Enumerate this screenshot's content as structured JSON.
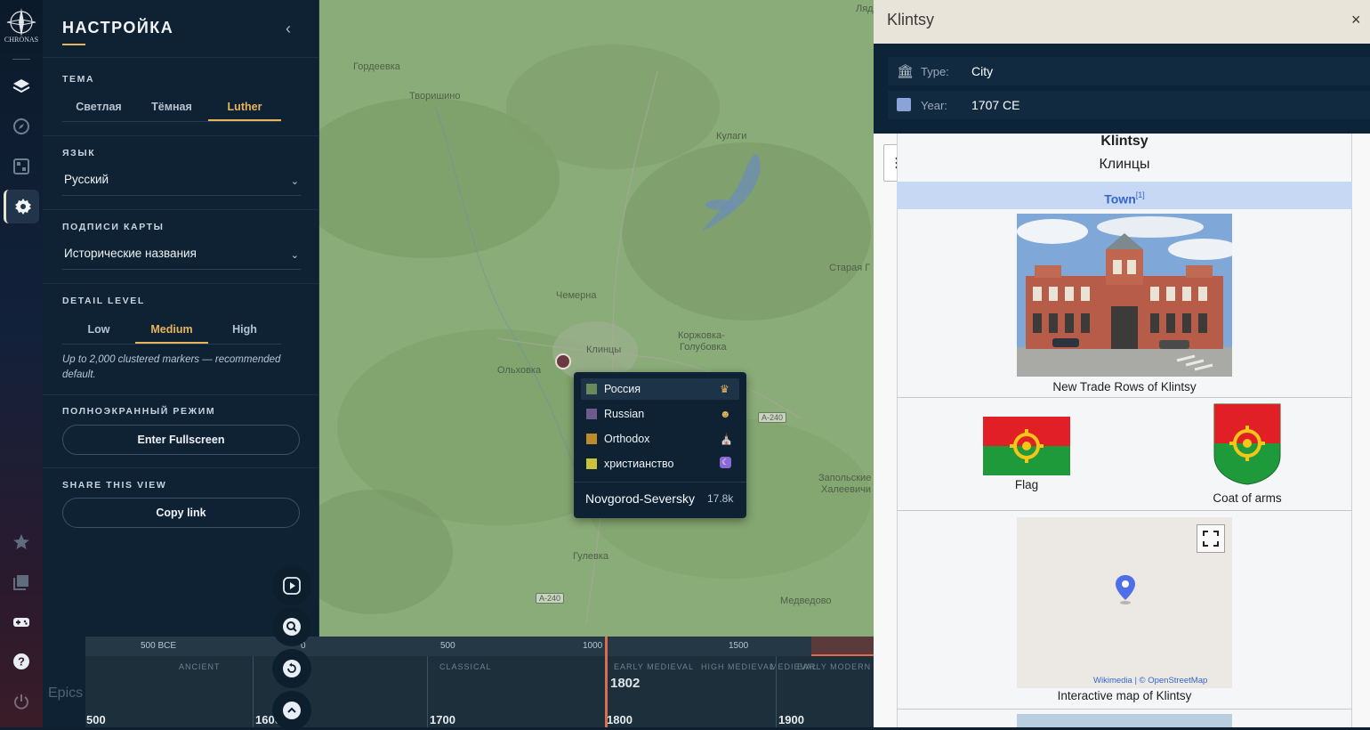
{
  "rail": {
    "logo_text": "CHRONAS",
    "epics_label": "Epics"
  },
  "settings": {
    "title": "НАСТРОЙКА",
    "theme": {
      "label": "ТЕМА",
      "options": [
        "Светлая",
        "Тёмная",
        "Luther"
      ],
      "selected": "Luther"
    },
    "language": {
      "label": "ЯЗЫК",
      "value": "Русский"
    },
    "map_labels": {
      "label": "ПОДПИСИ КАРТЫ",
      "value": "Исторические названия"
    },
    "detail": {
      "label": "DETAIL LEVEL",
      "options": [
        "Low",
        "Medium",
        "High"
      ],
      "selected": "Medium",
      "hint": "Up to 2,000 clustered markers — recommended default."
    },
    "fullscreen": {
      "label": "ПОЛНОЭКРАННЫЙ РЕЖИМ",
      "button": "Enter Fullscreen"
    },
    "share": {
      "label": "SHARE THIS VIEW",
      "button": "Copy link"
    }
  },
  "map": {
    "places": [
      "Ляд",
      "Гордеевка",
      "Творишино",
      "Кулаги",
      "Старая Г",
      "Чемерна",
      "Клинцы",
      "Коржовка-",
      "Голубовка",
      "Ольховка",
      "А-240",
      "Запольские",
      "Халеевичи",
      "Гулевка",
      "А-240",
      "Медведово"
    ],
    "tooltip": {
      "rows": [
        {
          "label": "Россия",
          "swatch": "#6b8a5c"
        },
        {
          "label": "Russian",
          "swatch": "#6c5c8c"
        },
        {
          "label": "Orthodox",
          "swatch": "#c08a2a"
        },
        {
          "label": "христианство",
          "swatch": "#c9c23a"
        }
      ],
      "footer_name": "Novgorod-Seversky",
      "footer_value": "17.8k"
    }
  },
  "timeline": {
    "top_ticks": [
      "500 BCE",
      "0",
      "500",
      "1000",
      "1500"
    ],
    "eras": [
      "ANCIENT",
      "CLASSICAL",
      "EARLY MEDIEVAL",
      "HIGH MEDIEVAL",
      "MEDIEVAL",
      "EARLY MODERN"
    ],
    "year_marker": "1802",
    "bottom_ticks": [
      "500",
      "1600",
      "1700",
      "1800",
      "1900"
    ]
  },
  "info_panel": {
    "header_title": "Klintsy",
    "close_label": "×",
    "type_label": "Type:",
    "type_value": "City",
    "year_label": "Year:",
    "year_value": "1707 CE",
    "wiki": {
      "title": "Klintsy",
      "native_name": "Клинцы",
      "category": "Town",
      "category_ref": "[1]",
      "photo_caption": "New Trade Rows of Klintsy",
      "flag_caption": "Flag",
      "coat_caption": "Coat of arms",
      "map_attribution_1": "Wikimedia",
      "map_attribution_2": "| © OpenStreetMap",
      "map_caption": "Interactive map of Klintsy"
    }
  },
  "colors": {
    "accent": "#e7b45a",
    "panel_bg": "#0f2234",
    "map_green": "#86a874",
    "timeline_marker": "#e06a4c",
    "wiki_category_bg": "#c6d8f4"
  }
}
